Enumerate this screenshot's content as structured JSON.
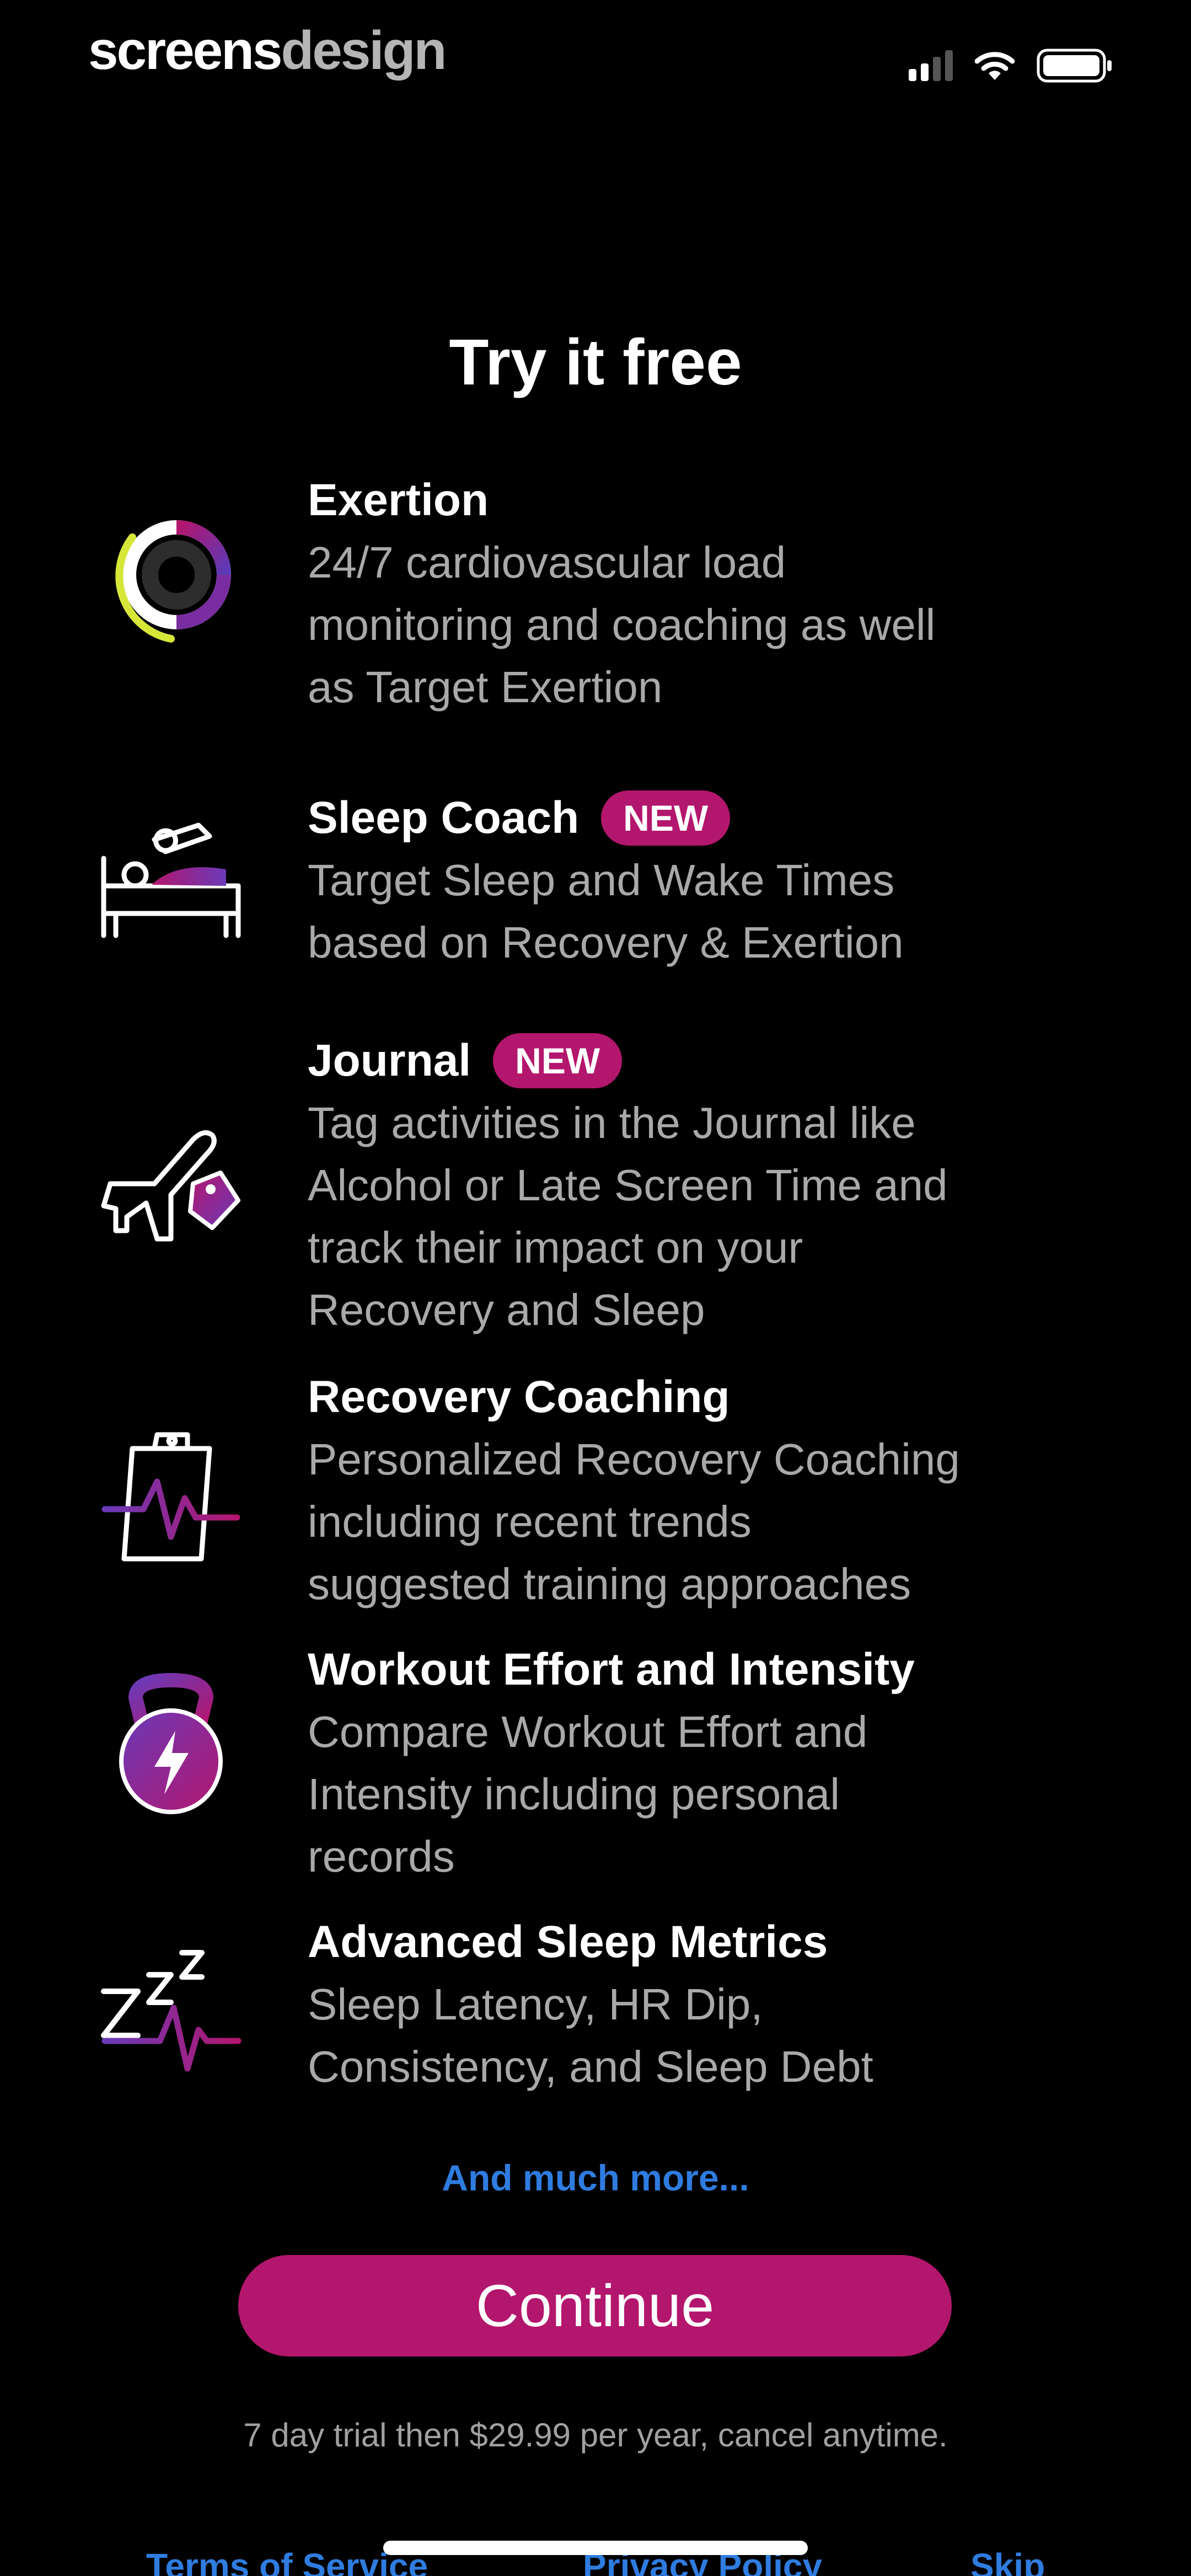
{
  "brand": {
    "part1": "screens",
    "part2": "design"
  },
  "status_bar": {
    "signal_icon": "cellular-signal-icon",
    "wifi_icon": "wifi-icon",
    "battery_icon": "battery-icon"
  },
  "title": "Try it free",
  "features": [
    {
      "icon": "exertion-ring-icon",
      "title": "Exertion",
      "badge": "",
      "description": "24/7 cardiovascular load\nmonitoring and coaching as well\nas Target Exertion"
    },
    {
      "icon": "sleep-coach-bed-icon",
      "title": "Sleep Coach",
      "badge": "NEW",
      "description": "Target Sleep and Wake Times\nbased on Recovery & Exertion"
    },
    {
      "icon": "journal-airplane-tag-icon",
      "title": "Journal",
      "badge": "NEW",
      "description": "Tag activities in the Journal like\nAlcohol or Late Screen Time and\ntrack their impact on your\nRecovery and Sleep"
    },
    {
      "icon": "recovery-clipboard-icon",
      "title": "Recovery Coaching",
      "badge": "",
      "description": "Personalized Recovery Coaching\nincluding recent trends\nsuggested training approaches"
    },
    {
      "icon": "kettlebell-lightning-icon",
      "title": "Workout Effort and Intensity",
      "badge": "",
      "description": "Compare Workout Effort and\nIntensity including personal\nrecords"
    },
    {
      "icon": "sleep-zzz-heartbeat-icon",
      "title": "Advanced Sleep Metrics",
      "badge": "",
      "description": "Sleep Latency, HR Dip,\nConsistency, and Sleep Debt"
    }
  ],
  "more_link": "And much more...",
  "continue_label": "Continue",
  "trial_text": "7 day trial then $29.99 per year, cancel anytime.",
  "footer": {
    "terms": "Terms of Service",
    "privacy": "Privacy Policy",
    "skip": "Skip"
  },
  "colors": {
    "accent_magenta": "#b3166d",
    "link_blue": "#2f7ce0",
    "text_gray": "#a9a9a9",
    "background": "#000000"
  }
}
